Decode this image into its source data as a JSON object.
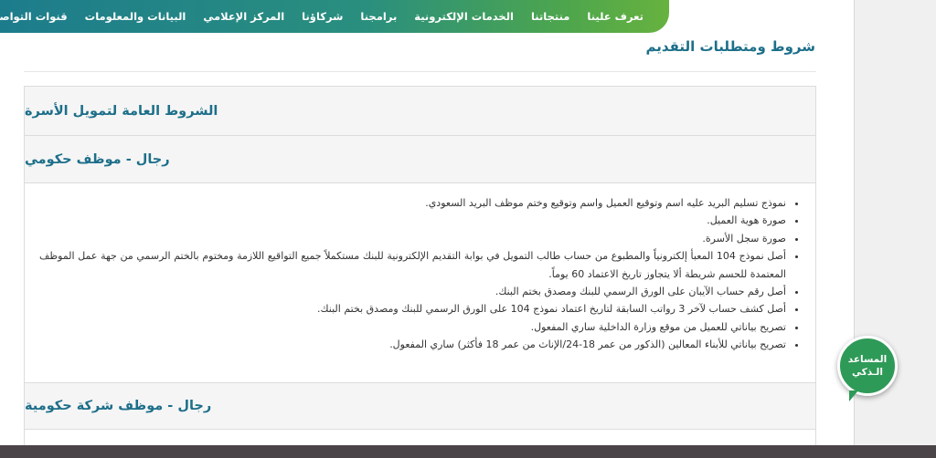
{
  "nav": {
    "items": [
      "تعرف علينا",
      "منتجاتنا",
      "الخدمات الإلكترونية",
      "برامجنا",
      "شركاؤنا",
      "المركز الإعلامي",
      "البيانات والمعلومات",
      "قنوات التواصل"
    ]
  },
  "page": {
    "title": "شروط ومتطلبات التقديم"
  },
  "panel": {
    "header_general": "الشروط العامة لتمويل الأسرة",
    "header_gov_employee": "رجال - موظف حكومي",
    "header_gov_company": "رجال - موظف شركة حكومية",
    "requirements": [
      "نموذج تسليم البريد عليه اسم وتوقيع العميل واسم وتوقيع وختم موظف البريد السعودي.",
      "صورة هوية العميل.",
      "صورة سجل الأسرة.",
      "أصل نموذج 104 المعبأ إلكترونياً والمطبوع من حساب طالب التمويل في بوابة التقديم الإلكترونية للبنك مستكملاً جميع التواقيع اللازمة ومختوم بالختم الرسمي من جهة عمل الموظف المعتمدة للحسم شريطة ألا يتجاوز تاريخ الاعتماد 60 يوماً.",
      "أصل رقم حساب الآيبان على الورق الرسمي للبنك ومصدق بختم البنك.",
      "أصل كشف حساب لآخر 3 رواتب السابقة لتاريخ اعتماد نموذج 104 على الورق الرسمي للبنك ومصدق بختم البنك.",
      "تصريح بياناتي للعميل من موقع وزارة الداخلية ساري المفعول.",
      "تصريح بياناتي للأبناء المعالين (الذكور من عمر 18-24/الإناث من عمر 18 فأكثر) ساري المفعول."
    ]
  },
  "assistant": {
    "line1": "المساعد",
    "line2": "الـذكي"
  },
  "colors": {
    "nav_start": "#1d7c8c",
    "nav_end": "#67b23f",
    "heading": "#1d6f8a",
    "assistant": "#2e9a57",
    "bottom_bar": "#4a4347"
  }
}
